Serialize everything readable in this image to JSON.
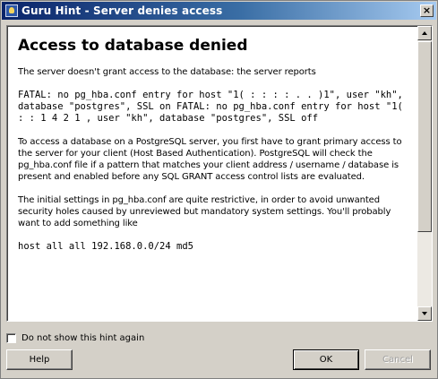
{
  "window": {
    "title": "Guru Hint - Server denies access",
    "close_glyph": "×"
  },
  "hint": {
    "heading": "Access to database denied",
    "intro": "The server doesn't grant access to the database: the server reports",
    "error_text": "FATAL: no pg_hba.conf entry for host \"1( : : : : . . )1\", user \"kh\", database \"postgres\", SSL on FATAL: no pg_hba.conf entry for host \"1( : : 1 4 2 1 , user \"kh\", database \"postgres\", SSL off",
    "explanation": "To access a database on a PostgreSQL server, you first have to grant primary access to the server for your client (Host Based Authentication). PostgreSQL will check the pg_hba.conf file if a pattern that matches your client address / username / database is present and enabled before any SQL GRANT access control lists are evaluated.",
    "settings_note": "The initial settings in pg_hba.conf are quite restrictive, in order to avoid unwanted security holes caused by unreviewed but mandatory system settings. You'll probably want to add something like",
    "config_line": "host all all 192.168.0.0/24 md5"
  },
  "options": {
    "dont_show_label": "Do not show this hint again",
    "dont_show_checked": false
  },
  "buttons": {
    "help": "Help",
    "ok": "OK",
    "cancel": "Cancel"
  }
}
